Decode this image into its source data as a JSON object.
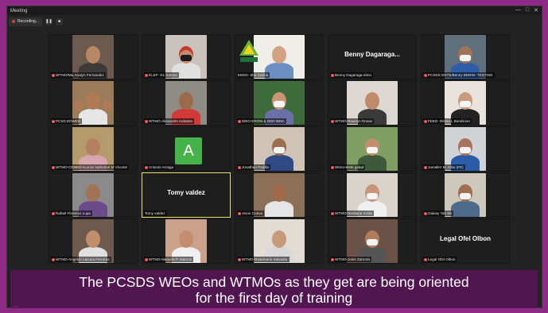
{
  "window": {
    "title": "Meeting",
    "controls": [
      "—",
      "□",
      "✕"
    ]
  },
  "toolbar": {
    "recording_label": "Recording...",
    "pause_icon": "pause-icon",
    "stop_icon": "stop-icon"
  },
  "participants": [
    {
      "label": "WTMO/Ma.Analyn Fernandez",
      "bg": "#6c5a4e",
      "skin": "#b88764",
      "shirt": "#3e3a3a",
      "mask": false,
      "muted": true
    },
    {
      "label": "ELEF- DL Santos",
      "bg": "#c9c2bd",
      "skin": "#c38d70",
      "shirt": "#e0e0e0",
      "mask": true,
      "hair": "#c93a2e",
      "muted": true
    },
    {
      "label": "EEED- Sha Carlos",
      "bg": "#f0eee8",
      "skin": "#d2a383",
      "shirt": "#6a8fc0",
      "mask": false,
      "logo": true,
      "muted": false
    },
    {
      "label": "Benny Dagaraga-elmo",
      "display": "Benny Dagaraga...",
      "muted": true
    },
    {
      "label": "PCSDS ENTS/Benny BEDIN- TESTING",
      "bg": "#5f6f7c",
      "skin": "#a0755a",
      "shirt": "#2f5ea8",
      "mask": true,
      "muted": true
    },
    {
      "label": "PCSD EDWED",
      "bg": "#9a7b5a",
      "skin": "#b07a56",
      "shirt": "#e5e5e5",
      "mask": false,
      "group": true,
      "muted": true
    },
    {
      "label": "WTMO-Alexandro Ardolnte",
      "bg": "#8f8b85",
      "skin": "#9b6a49",
      "shirt": "#d23a3a",
      "mask": false,
      "muted": true
    },
    {
      "label": "WEO EROM & DDD IBNA",
      "bg": "#3e6b3a",
      "skin": "#c99575",
      "shirt": "#6b6fa8",
      "mask": true,
      "muted": true
    },
    {
      "label": "WTMO-Roselyn Rosas",
      "bg": "#ddd8d2",
      "skin": "#c08a6a",
      "shirt": "#3a3a3a",
      "mask": false,
      "muted": true
    },
    {
      "label": "FEED- Rishia L Bendicion",
      "bg": "#e8e3dd",
      "skin": "#c99a7c",
      "shirt": "#222",
      "mask": true,
      "muted": true
    },
    {
      "label": "WTMO-CEMED-Kunzie katherine M Viconte",
      "bg": "#b39b6b",
      "skin": "#b48060",
      "shirt": "#d9a6b0",
      "mask": false,
      "muted": true
    },
    {
      "label": "Antonio Arzaga",
      "avatar_letter": "A",
      "muted": true
    },
    {
      "label": "Jonathan Padilla",
      "bg": "#cfc4b6",
      "skin": "#9d6d4f",
      "shirt": "#2f4a85",
      "mask": true,
      "muted": true
    },
    {
      "label": "Wtmo-Mele gabat",
      "bg": "#7f9e63",
      "skin": "#c68f6c",
      "shirt": "#3d5b3a",
      "mask": true,
      "muted": true
    },
    {
      "label": "Jamaller M. Arbo (FE)",
      "bg": "#cfd3d6",
      "skin": "#a8735a",
      "shirt": "#2a5ca8",
      "mask": true,
      "muted": true
    },
    {
      "label": "Rafael Florenco Lupa",
      "bg": "#8a8a8a",
      "skin": "#a37153",
      "shirt": "#6b4b8a",
      "mask": false,
      "muted": true
    },
    {
      "label": "Tomy valdez",
      "display": "Tomy valdez",
      "active": true,
      "muted": false
    },
    {
      "label": "Aivon Cueva",
      "bg": "#8c6f57",
      "skin": "#a06a48",
      "shirt": "#e5e5e5",
      "mask": false,
      "muted": true
    },
    {
      "label": "WTMO-Nestlane Ariola",
      "bg": "#d9d3cc",
      "skin": "#c79478",
      "shirt": "#efefef",
      "mask": true,
      "muted": true
    },
    {
      "label": "Galaxy Tab S6",
      "bg": "#cdc7bc",
      "skin": "#a06e50",
      "shirt": "#4e6a8a",
      "mask": true,
      "muted": true
    },
    {
      "label": "WTMO-Angelyn Lacuna Ferreras",
      "bg": "#6d5a4c",
      "skin": "#c28d6a",
      "shirt": "#e0e0e0",
      "mask": false,
      "muted": true
    },
    {
      "label": "WTMO-Marjorie P. Marcos",
      "bg": "#caa28a",
      "skin": "#c38f6f",
      "shirt": "#f0f0f0",
      "mask": false,
      "muted": true
    },
    {
      "label": "WTMO-Rosemarie Salvador",
      "bg": "#e2dcd4",
      "skin": "#c79a7b",
      "shirt": "#d8d8d8",
      "mask": false,
      "muted": true
    },
    {
      "label": "WTMO-Josie Zamora",
      "bg": "#6a5346",
      "skin": "#b17c5b",
      "shirt": "#555",
      "mask": true,
      "muted": true
    },
    {
      "label": "Legal Ofel Olbon",
      "display": "Legal Ofel Olbon",
      "muted": true
    }
  ],
  "caption": {
    "line1": "The PCSDS WEOs and WTMOs as they get are being oriented",
    "line2": "for the first day of training"
  },
  "bottom": {
    "camera_icon": "camera-icon"
  }
}
